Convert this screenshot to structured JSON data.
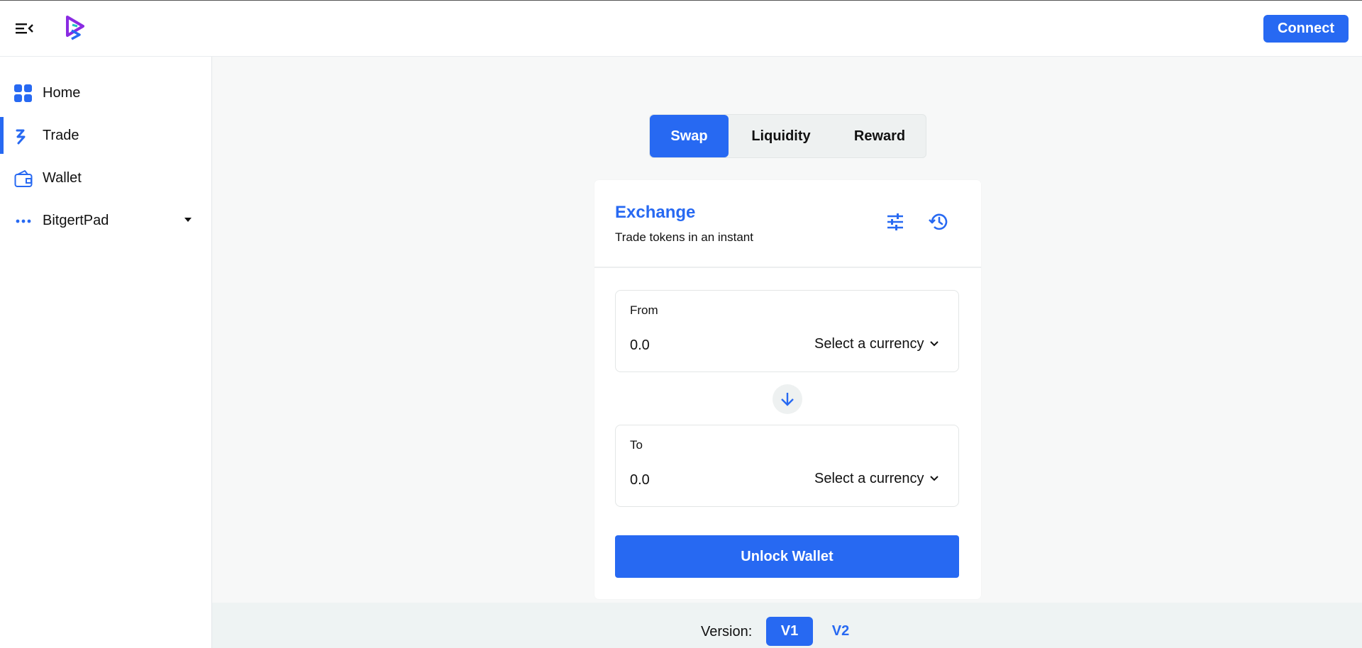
{
  "header": {
    "connect_label": "Connect"
  },
  "sidebar": {
    "items": [
      {
        "label": "Home",
        "icon": "grid-icon"
      },
      {
        "label": "Trade",
        "icon": "trade-icon"
      },
      {
        "label": "Wallet",
        "icon": "wallet-icon"
      },
      {
        "label": "BitgertPad",
        "icon": "more-dots-icon"
      }
    ],
    "active": "Trade"
  },
  "tabs": [
    {
      "label": "Swap"
    },
    {
      "label": "Liquidity"
    },
    {
      "label": "Reward"
    }
  ],
  "exchange": {
    "title": "Exchange",
    "subtitle": "Trade tokens in an instant",
    "from": {
      "label": "From",
      "placeholder": "0.0",
      "currency": "Select a currency"
    },
    "to": {
      "label": "To",
      "placeholder": "0.0",
      "currency": "Select a currency"
    },
    "unlock_label": "Unlock Wallet"
  },
  "footer": {
    "version_label": "Version:",
    "v1": "V1",
    "v2": "V2"
  },
  "colors": {
    "accent": "#2769f2",
    "main_bg": "#f7f8f8",
    "footer_bg": "#eef3f3"
  }
}
